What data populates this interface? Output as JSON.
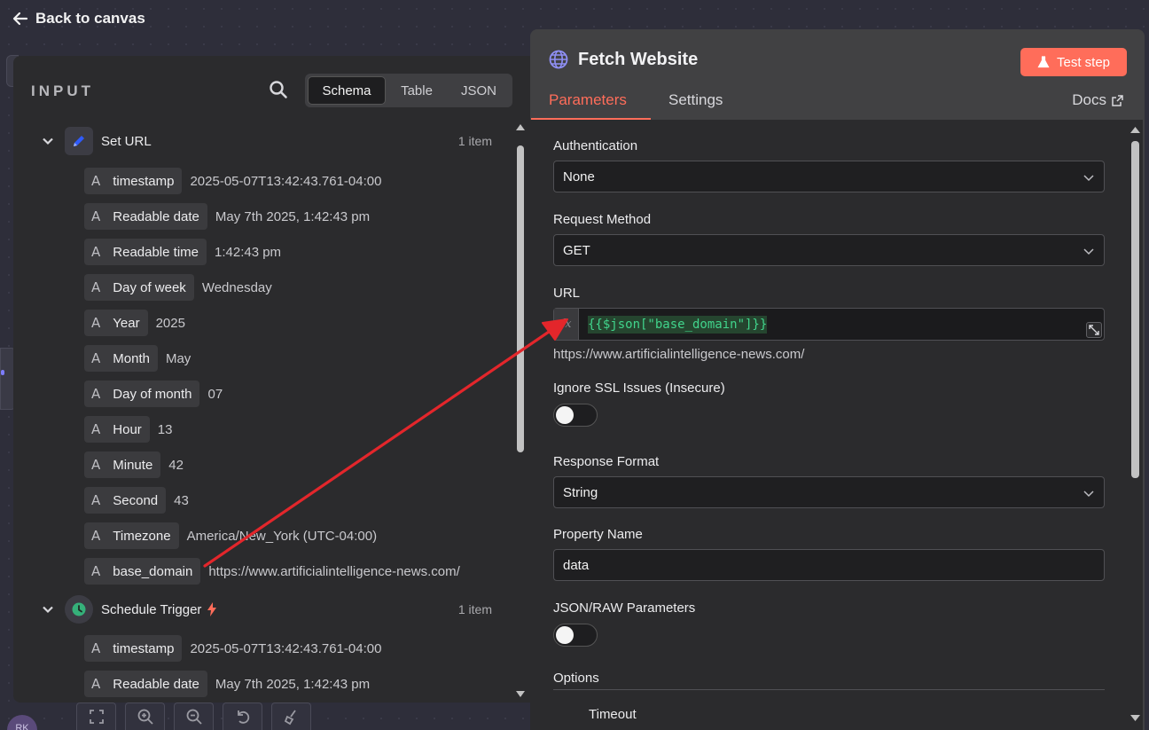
{
  "nav": {
    "back_label": "Back to canvas"
  },
  "canvas": {
    "avatar_initials": "RK"
  },
  "input_panel": {
    "title": "INPUT",
    "view_tabs": [
      {
        "label": "Schema",
        "active": true
      },
      {
        "label": "Table",
        "active": false
      },
      {
        "label": "JSON",
        "active": false
      }
    ],
    "nodes": [
      {
        "name": "Set URL",
        "icon": "pen-icon",
        "count": "1 item",
        "fields": [
          {
            "key": "timestamp",
            "value": "2025-05-07T13:42:43.761-04:00"
          },
          {
            "key": "Readable date",
            "value": "May 7th 2025, 1:42:43 pm"
          },
          {
            "key": "Readable time",
            "value": "1:42:43 pm"
          },
          {
            "key": "Day of week",
            "value": "Wednesday"
          },
          {
            "key": "Year",
            "value": "2025"
          },
          {
            "key": "Month",
            "value": "May"
          },
          {
            "key": "Day of month",
            "value": "07"
          },
          {
            "key": "Hour",
            "value": "13"
          },
          {
            "key": "Minute",
            "value": "42"
          },
          {
            "key": "Second",
            "value": "43"
          },
          {
            "key": "Timezone",
            "value": "America/New_York (UTC-04:00)"
          },
          {
            "key": "base_domain",
            "value": "https://www.artificialintelligence-news.com/"
          }
        ]
      },
      {
        "name": "Schedule Trigger",
        "icon": "clock-icon",
        "count": "1 item",
        "fields": [
          {
            "key": "timestamp",
            "value": "2025-05-07T13:42:43.761-04:00"
          },
          {
            "key": "Readable date",
            "value": "May 7th 2025, 1:42:43 pm"
          }
        ]
      }
    ]
  },
  "node_panel": {
    "title": "Fetch Website",
    "test_button": "Test step",
    "tabs": [
      {
        "label": "Parameters",
        "active": true
      },
      {
        "label": "Settings",
        "active": false
      }
    ],
    "docs_label": "Docs",
    "params": {
      "authentication": {
        "label": "Authentication",
        "value": "None"
      },
      "request_method": {
        "label": "Request Method",
        "value": "GET"
      },
      "url": {
        "label": "URL",
        "fx": "fx",
        "expression": "{{$json[\"base_domain\"]}}",
        "result": "https://www.artificialintelligence-news.com/"
      },
      "ignore_ssl": {
        "label": "Ignore SSL Issues (Insecure)",
        "on": false
      },
      "response_format": {
        "label": "Response Format",
        "value": "String"
      },
      "property_name": {
        "label": "Property Name",
        "value": "data"
      },
      "json_raw": {
        "label": "JSON/RAW Parameters",
        "on": false
      },
      "options": {
        "label": "Options",
        "sub_label": "Timeout"
      }
    }
  },
  "colors": {
    "accent": "#ff6d5a",
    "expression": "#41d48c",
    "annotation_arrow": "#e3262b"
  }
}
